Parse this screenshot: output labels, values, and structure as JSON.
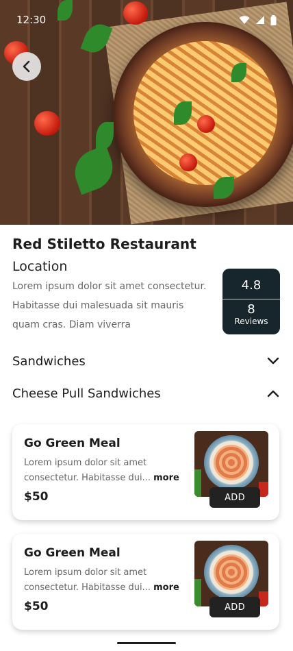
{
  "status_bar": {
    "time": "12:30"
  },
  "restaurant": {
    "name": "Red Stiletto Restaurant",
    "location": "Location",
    "description": "Lorem ipsum dolor sit amet consectetur. Habitasse dui malesuada sit mauris quam cras. Diam viverra"
  },
  "rating": {
    "score": "4.8",
    "reviews_count": "8",
    "reviews_label": "Reviews"
  },
  "sections": [
    {
      "label": "Sandwiches",
      "state": "collapsed"
    },
    {
      "label": "Cheese Pull Sandwiches",
      "state": "expanded"
    }
  ],
  "menu_items": [
    {
      "name": "Go Green Meal",
      "description": "Lorem ipsum dolor sit amet consectetur. Habitasse dui...",
      "more_label": "more",
      "price": "$50",
      "add_label": "ADD"
    },
    {
      "name": "Go Green Meal",
      "description": "Lorem ipsum dolor sit amet consectetur. Habitasse dui...",
      "more_label": "more",
      "price": "$50",
      "add_label": "ADD"
    }
  ],
  "icons": {
    "back": "chevron-left-icon",
    "wifi": "wifi-icon",
    "signal": "signal-icon",
    "battery": "battery-icon",
    "collapse": "chevron-down-icon",
    "expand": "chevron-up-icon"
  },
  "colors": {
    "rating_box_bg": "#16262c",
    "add_button_bg": "#222222"
  }
}
